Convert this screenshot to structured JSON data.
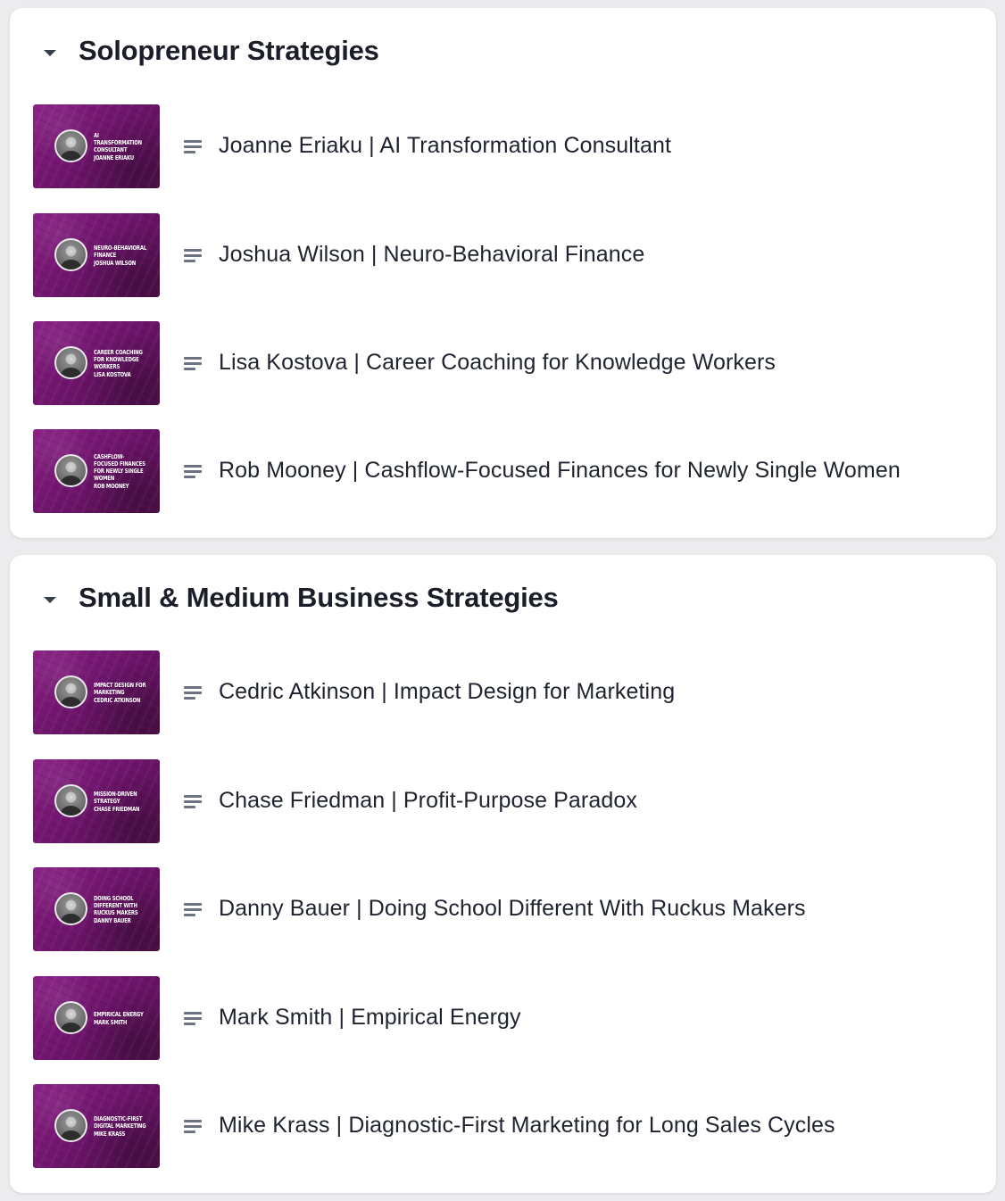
{
  "sections": [
    {
      "title": "Solopreneur Strategies",
      "lessons": [
        {
          "title": "Joanne Eriaku | AI Transformation Consultant",
          "thumb_topic": "AI Transformation Consultant",
          "thumb_name": "Joanne Eriaku"
        },
        {
          "title": "Joshua Wilson | Neuro-Behavioral Finance",
          "thumb_topic": "Neuro-Behavioral Finance",
          "thumb_name": "Joshua Wilson"
        },
        {
          "title": "Lisa Kostova | Career Coaching for Knowledge Workers",
          "thumb_topic": "Career Coaching For Knowledge Workers",
          "thumb_name": "Lisa Kostova"
        },
        {
          "title": "Rob Mooney | Cashflow-Focused Finances for Newly Single Women",
          "thumb_topic": "Cashflow-Focused Finances For Newly Single Women",
          "thumb_name": "Rob Mooney"
        }
      ]
    },
    {
      "title": "Small & Medium Business Strategies",
      "lessons": [
        {
          "title": "Cedric Atkinson | Impact Design for Marketing",
          "thumb_topic": "Impact Design For Marketing",
          "thumb_name": "Cedric Atkinson"
        },
        {
          "title": "Chase Friedman | Profit-Purpose Paradox",
          "thumb_topic": "Mission-Driven Strategy",
          "thumb_name": "Chase Friedman"
        },
        {
          "title": "Danny Bauer | Doing School Different With Ruckus Makers",
          "thumb_topic": "Doing School Different With Ruckus Makers",
          "thumb_name": "Danny Bauer"
        },
        {
          "title": "Mark Smith | Empirical Energy",
          "thumb_topic": "Empirical Energy",
          "thumb_name": "Mark Smith"
        },
        {
          "title": "Mike Krass | Diagnostic-First Marketing for Long Sales Cycles",
          "thumb_topic": "Diagnostic-First Digital Marketing",
          "thumb_name": "Mike Krass"
        }
      ]
    }
  ],
  "colors": {
    "page_background": "#ececef",
    "card_background": "#ffffff",
    "thumbnail_purple": "#7a1a77",
    "title_text": "#1b1e28",
    "icon_gray": "#6c7280"
  },
  "icons": {
    "section_toggle": "caret-down-icon",
    "lesson_type": "text-lines-icon"
  }
}
